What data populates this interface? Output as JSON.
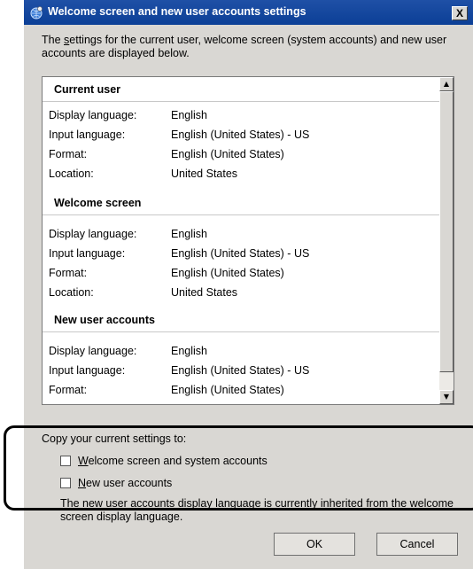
{
  "window": {
    "title": "Welcome screen and new user accounts settings",
    "close_label": "X"
  },
  "intro": {
    "pre": "The ",
    "underlined": "s",
    "post": "ettings for the current user, welcome screen (system accounts) and new user accounts are displayed below."
  },
  "sections": [
    {
      "title": "Current user",
      "rows": [
        {
          "label": "Display language:",
          "value": "English"
        },
        {
          "label": "Input language:",
          "value": "English (United States) - US"
        },
        {
          "label": "Format:",
          "value": "English (United States)"
        },
        {
          "label": "Location:",
          "value": "United States"
        }
      ]
    },
    {
      "title": "Welcome screen",
      "rows": [
        {
          "label": "Display language:",
          "value": "English"
        },
        {
          "label": "Input language:",
          "value": "English (United States) - US"
        },
        {
          "label": "Format:",
          "value": "English (United States)"
        },
        {
          "label": "Location:",
          "value": "United States"
        }
      ]
    },
    {
      "title": "New user accounts",
      "rows": [
        {
          "label": "Display language:",
          "value": "English"
        },
        {
          "label": "Input language:",
          "value": "English (United States) - US"
        },
        {
          "label": "Format:",
          "value": "English (United States)"
        }
      ]
    }
  ],
  "copy": {
    "label": "Copy your current settings to:",
    "options": [
      {
        "underlined": "W",
        "rest": "elcome screen and system accounts",
        "checked": false
      },
      {
        "underlined": "N",
        "rest": "ew user accounts",
        "checked": false
      }
    ]
  },
  "note": "The new user accounts display language is currently inherited from the welcome screen display language.",
  "buttons": {
    "ok": "OK",
    "cancel": "Cancel"
  }
}
